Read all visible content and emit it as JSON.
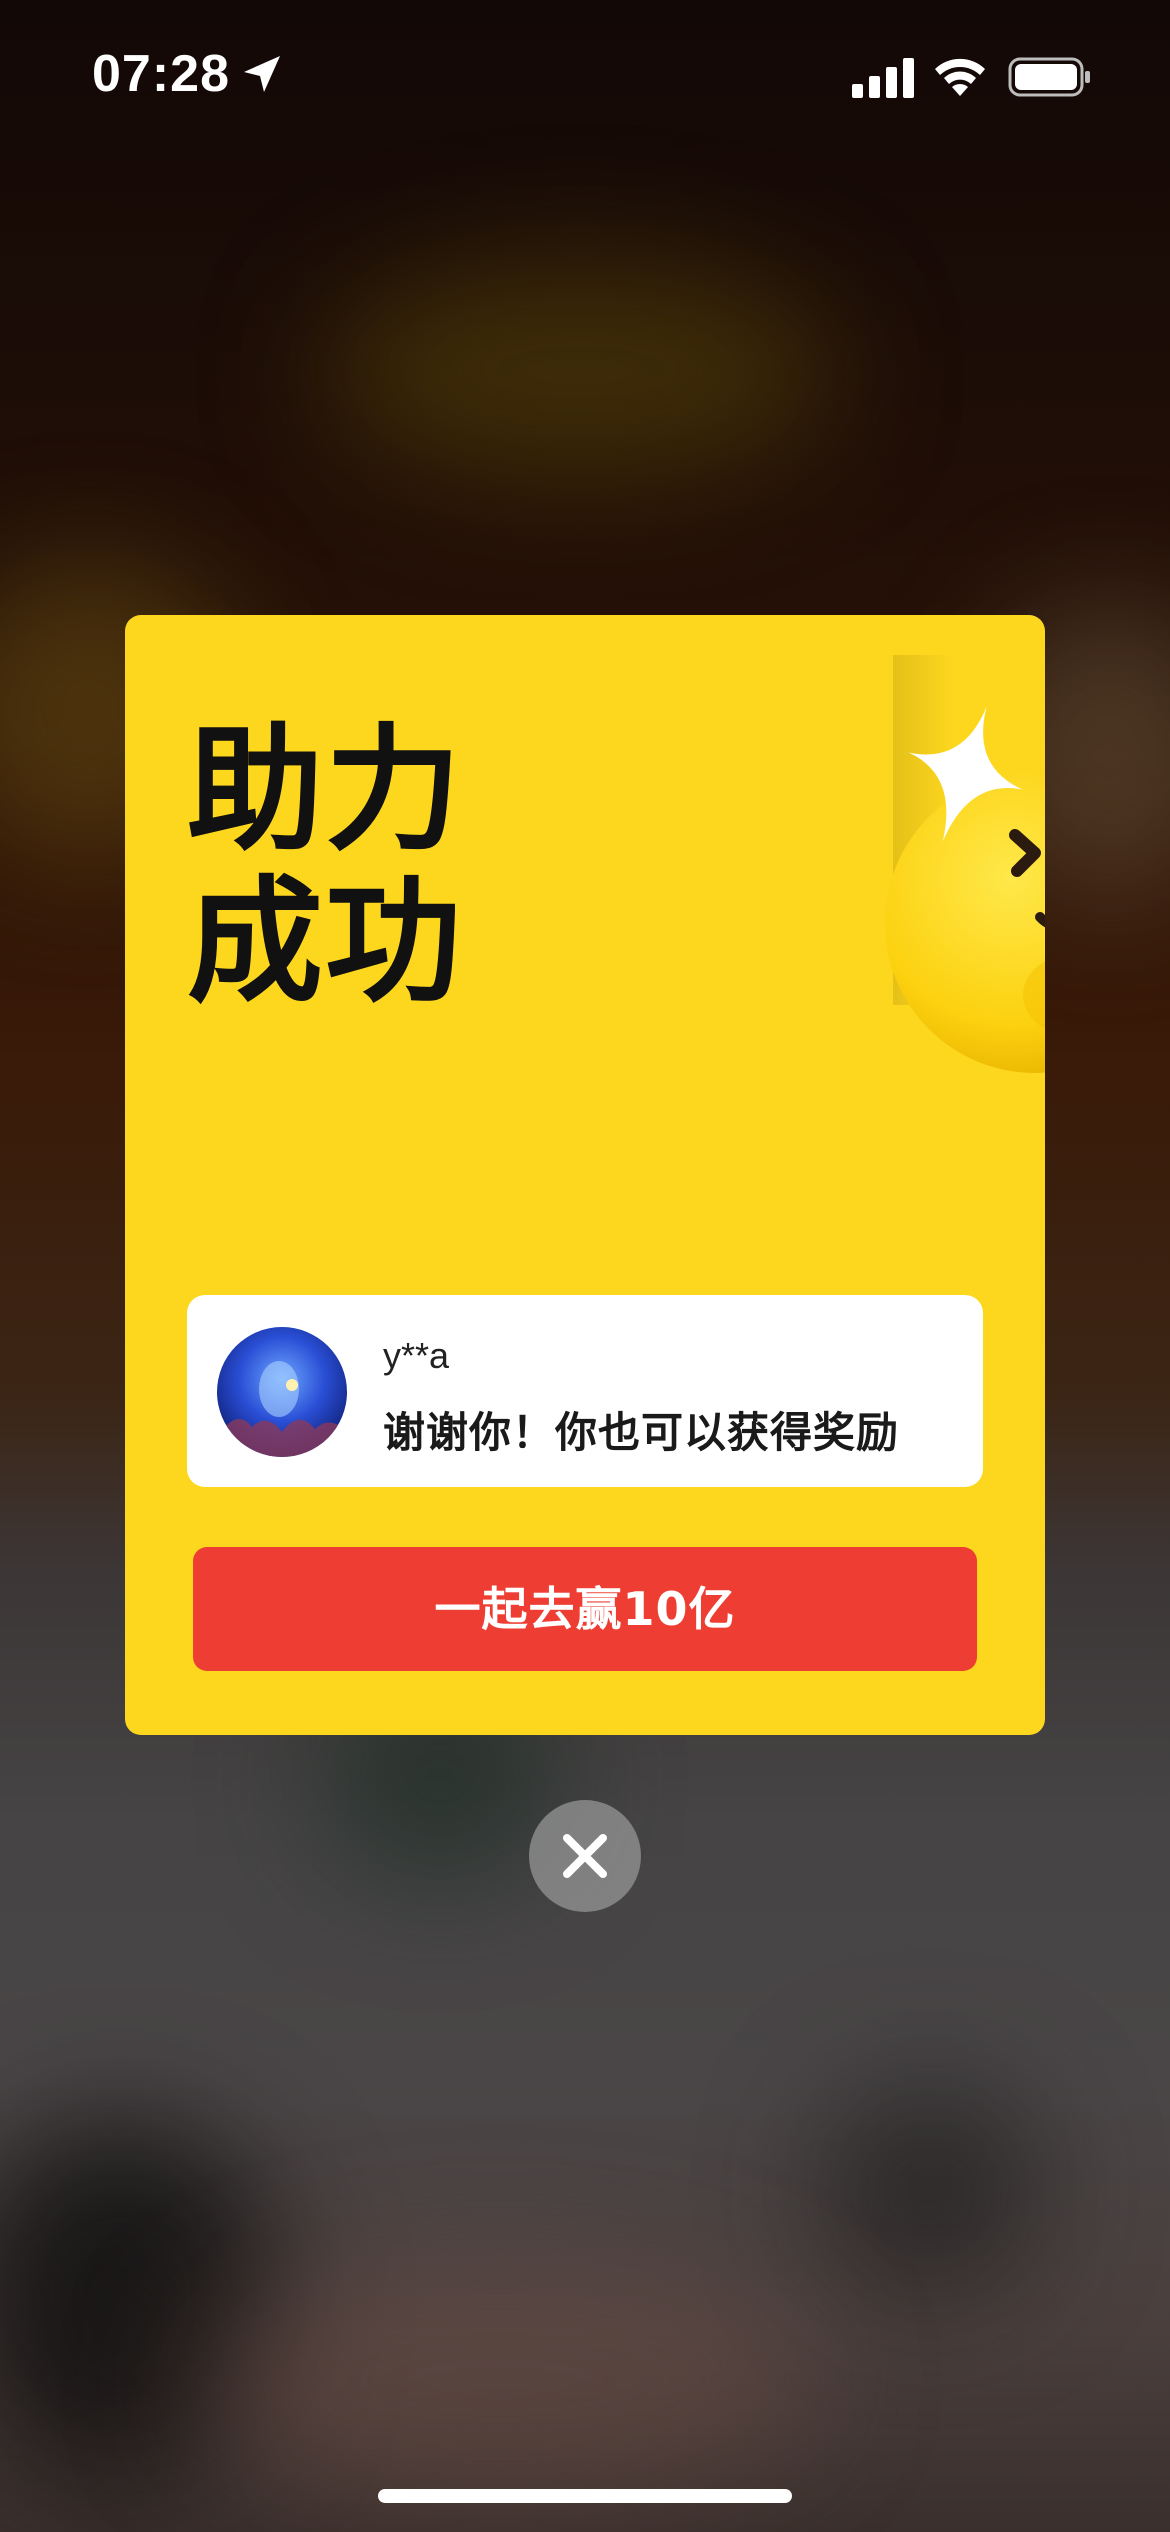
{
  "status_bar": {
    "time": "07:28",
    "icons": [
      "location-arrow-icon",
      "cellular-signal-icon",
      "wifi-icon",
      "battery-icon"
    ]
  },
  "modal": {
    "title_line1": "助力",
    "title_line2": "成功",
    "mascot": "winking-emoji-mascot",
    "message": {
      "username": "y**a",
      "text": "谢谢你！你也可以获得奖励"
    },
    "cta_label": "一起去赢10亿",
    "close_icon": "close-icon"
  },
  "colors": {
    "card_background": "#fdd71e",
    "cta_background": "#ee3e33",
    "message_background": "#ffffff",
    "close_background": "#8c8c8c"
  }
}
